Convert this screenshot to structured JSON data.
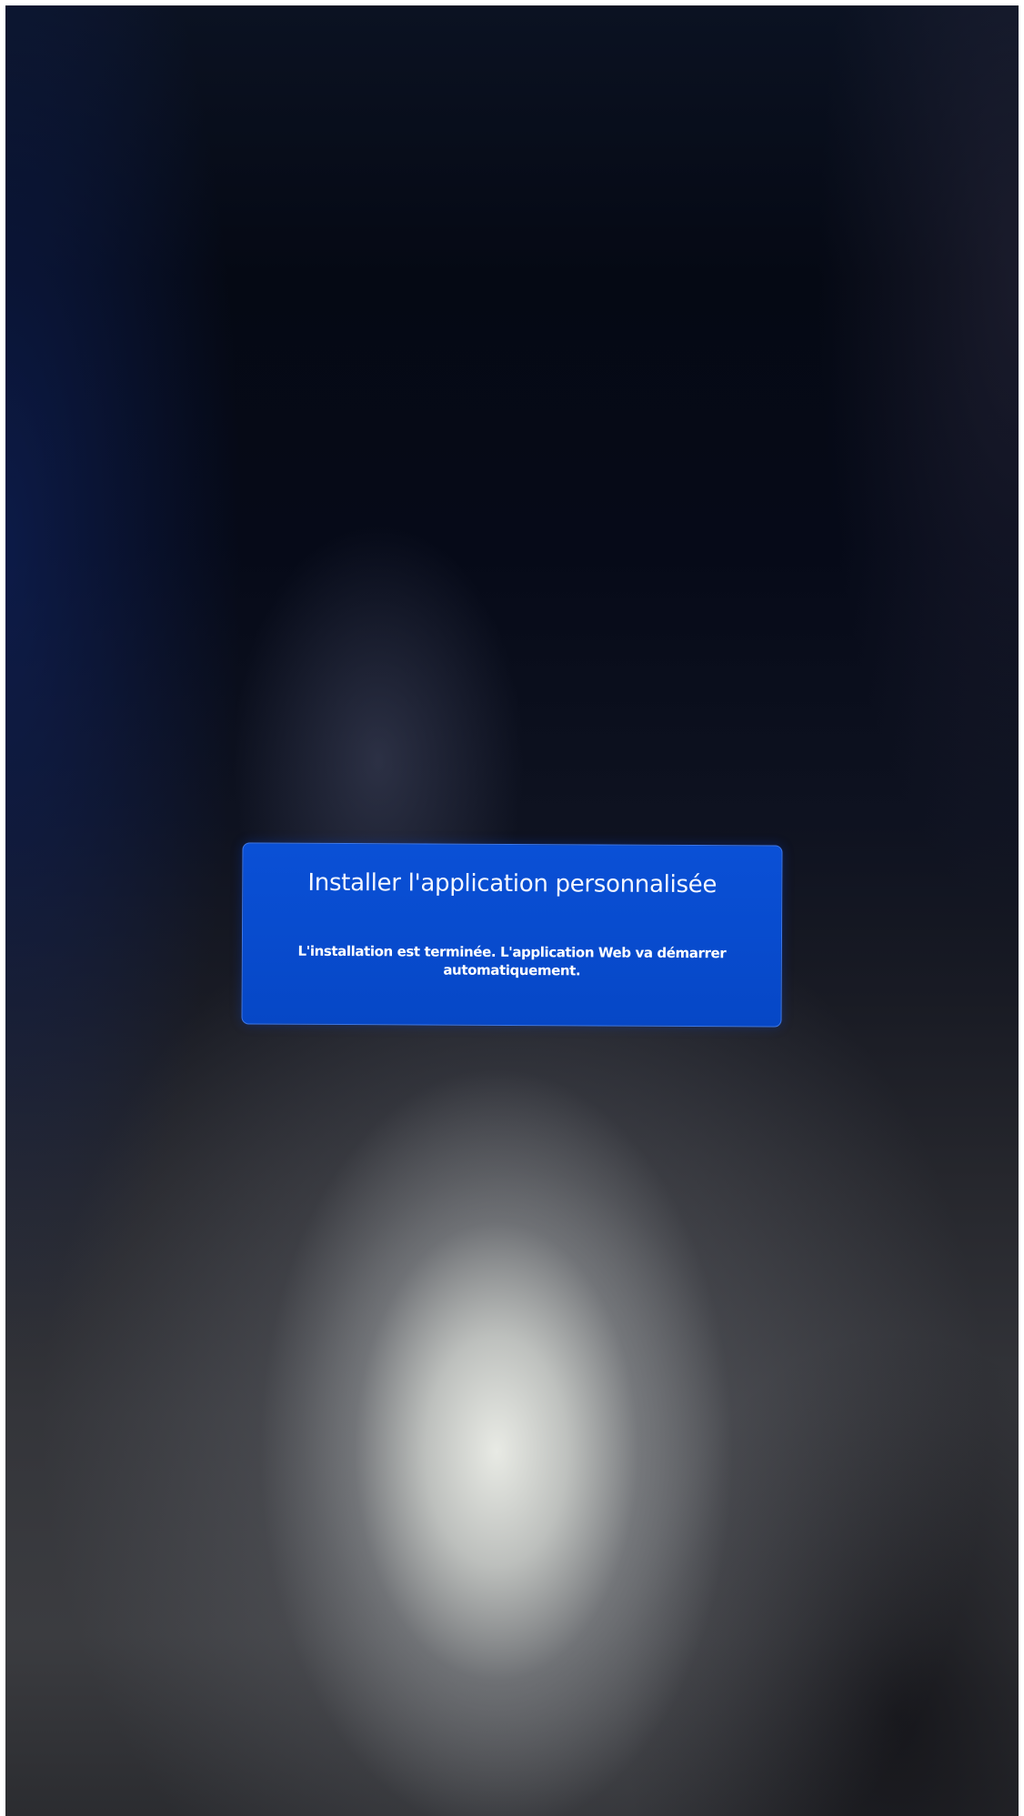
{
  "dialog": {
    "title": "Installer l'application personnalisée",
    "message": "L'installation est terminée. L'application Web va démarrer automatiquement.",
    "background_color": "#0647c6"
  }
}
